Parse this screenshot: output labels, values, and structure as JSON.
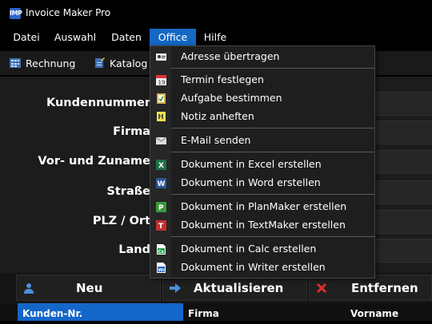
{
  "window": {
    "title": "Invoice Maker Pro",
    "icon_text": "IMP"
  },
  "menubar": {
    "items": [
      {
        "label": "Datei"
      },
      {
        "label": "Auswahl"
      },
      {
        "label": "Daten"
      },
      {
        "label": "Office"
      },
      {
        "label": "Hilfe"
      }
    ],
    "active": "Office"
  },
  "toolbar": {
    "rechnung_label": "Rechnung",
    "katalog_label": "Katalog"
  },
  "form": {
    "labels": [
      "Kundennummer",
      "Firma",
      "Vor- und Zuname",
      "Straße",
      "PLZ / Ort",
      "Land"
    ]
  },
  "buttons": {
    "neu": "Neu",
    "aktualisieren": "Aktualisieren",
    "entfernen": "Entfernen"
  },
  "grid": {
    "columns": [
      "Kunden-Nr.",
      "Firma",
      "Vorname"
    ]
  },
  "office_menu": {
    "items": [
      {
        "label": "Adresse übertragen",
        "icon": "address-card-icon"
      },
      {
        "label": "Termin festlegen",
        "icon": "calendar-icon"
      },
      {
        "label": "Aufgabe bestimmen",
        "icon": "clipboard-icon"
      },
      {
        "label": "Notiz anheften",
        "icon": "sticky-note-icon"
      },
      {
        "label": "E-Mail senden",
        "icon": "envelope-icon"
      },
      {
        "label": "Dokument in Excel erstellen",
        "icon": "excel-icon"
      },
      {
        "label": "Dokument in Word erstellen",
        "icon": "word-icon"
      },
      {
        "label": "Dokument in PlanMaker erstellen",
        "icon": "planmaker-icon"
      },
      {
        "label": "Dokument in TextMaker erstellen",
        "icon": "textmaker-icon"
      },
      {
        "label": "Dokument in Calc erstellen",
        "icon": "calc-icon"
      },
      {
        "label": "Dokument in Writer erstellen",
        "icon": "writer-icon"
      }
    ]
  }
}
